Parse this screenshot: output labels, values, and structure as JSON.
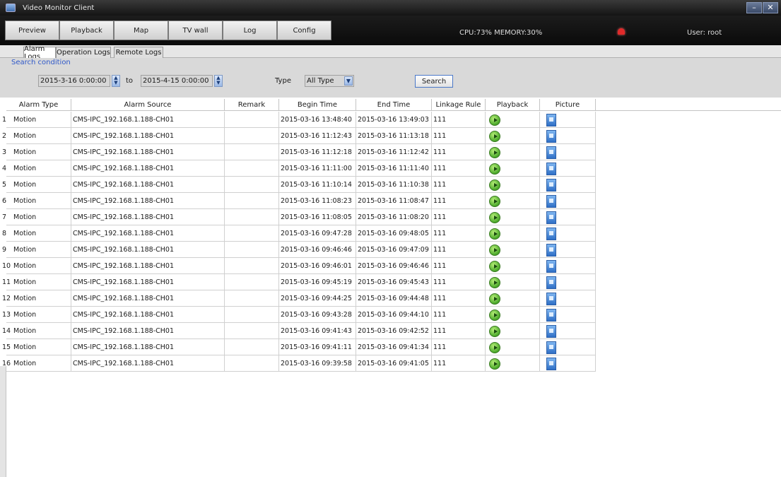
{
  "window": {
    "title": "Video Monitor Client",
    "minimize": "–",
    "close": "✕"
  },
  "menu": {
    "tabs": [
      "Preview",
      "Playback",
      "Map",
      "TV wall",
      "Log",
      "Config"
    ],
    "status": "CPU:73%  MEMORY:30%",
    "user": "User: root"
  },
  "subtabs": [
    "Alarm Logs",
    "Operation Logs",
    "Remote Logs"
  ],
  "search": {
    "legend": "Search condition",
    "start": "2015-3-16 0:00:00",
    "to_label": "to",
    "end": "2015-4-15 0:00:00",
    "type_label": "Type",
    "type_value": "All Type",
    "button": "Search"
  },
  "table": {
    "headers": [
      "Alarm Type",
      "Alarm Source",
      "Remark",
      "Begin Time",
      "End Time",
      "Linkage Rule",
      "Playback",
      "Picture"
    ],
    "rows": [
      {
        "idx": "1",
        "type": "Motion",
        "source": "CMS-IPC_192.168.1.188-CH01",
        "remark": "",
        "begin": "2015-03-16 13:48:40",
        "end": "2015-03-16 13:49:03",
        "rule": "111"
      },
      {
        "idx": "2",
        "type": "Motion",
        "source": "CMS-IPC_192.168.1.188-CH01",
        "remark": "",
        "begin": "2015-03-16 11:12:43",
        "end": "2015-03-16 11:13:18",
        "rule": "111"
      },
      {
        "idx": "3",
        "type": "Motion",
        "source": "CMS-IPC_192.168.1.188-CH01",
        "remark": "",
        "begin": "2015-03-16 11:12:18",
        "end": "2015-03-16 11:12:42",
        "rule": "111"
      },
      {
        "idx": "4",
        "type": "Motion",
        "source": "CMS-IPC_192.168.1.188-CH01",
        "remark": "",
        "begin": "2015-03-16 11:11:00",
        "end": "2015-03-16 11:11:40",
        "rule": "111"
      },
      {
        "idx": "5",
        "type": "Motion",
        "source": "CMS-IPC_192.168.1.188-CH01",
        "remark": "",
        "begin": "2015-03-16 11:10:14",
        "end": "2015-03-16 11:10:38",
        "rule": "111"
      },
      {
        "idx": "6",
        "type": "Motion",
        "source": "CMS-IPC_192.168.1.188-CH01",
        "remark": "",
        "begin": "2015-03-16 11:08:23",
        "end": "2015-03-16 11:08:47",
        "rule": "111"
      },
      {
        "idx": "7",
        "type": "Motion",
        "source": "CMS-IPC_192.168.1.188-CH01",
        "remark": "",
        "begin": "2015-03-16 11:08:05",
        "end": "2015-03-16 11:08:20",
        "rule": "111"
      },
      {
        "idx": "8",
        "type": "Motion",
        "source": "CMS-IPC_192.168.1.188-CH01",
        "remark": "",
        "begin": "2015-03-16 09:47:28",
        "end": "2015-03-16 09:48:05",
        "rule": "111"
      },
      {
        "idx": "9",
        "type": "Motion",
        "source": "CMS-IPC_192.168.1.188-CH01",
        "remark": "",
        "begin": "2015-03-16 09:46:46",
        "end": "2015-03-16 09:47:09",
        "rule": "111"
      },
      {
        "idx": "10",
        "type": "Motion",
        "source": "CMS-IPC_192.168.1.188-CH01",
        "remark": "",
        "begin": "2015-03-16 09:46:01",
        "end": "2015-03-16 09:46:46",
        "rule": "111"
      },
      {
        "idx": "11",
        "type": "Motion",
        "source": "CMS-IPC_192.168.1.188-CH01",
        "remark": "",
        "begin": "2015-03-16 09:45:19",
        "end": "2015-03-16 09:45:43",
        "rule": "111"
      },
      {
        "idx": "12",
        "type": "Motion",
        "source": "CMS-IPC_192.168.1.188-CH01",
        "remark": "",
        "begin": "2015-03-16 09:44:25",
        "end": "2015-03-16 09:44:48",
        "rule": "111"
      },
      {
        "idx": "13",
        "type": "Motion",
        "source": "CMS-IPC_192.168.1.188-CH01",
        "remark": "",
        "begin": "2015-03-16 09:43:28",
        "end": "2015-03-16 09:44:10",
        "rule": "111"
      },
      {
        "idx": "14",
        "type": "Motion",
        "source": "CMS-IPC_192.168.1.188-CH01",
        "remark": "",
        "begin": "2015-03-16 09:41:43",
        "end": "2015-03-16 09:42:52",
        "rule": "111"
      },
      {
        "idx": "15",
        "type": "Motion",
        "source": "CMS-IPC_192.168.1.188-CH01",
        "remark": "",
        "begin": "2015-03-16 09:41:11",
        "end": "2015-03-16 09:41:34",
        "rule": "111"
      },
      {
        "idx": "16",
        "type": "Motion",
        "source": "CMS-IPC_192.168.1.188-CH01",
        "remark": "",
        "begin": "2015-03-16 09:39:58",
        "end": "2015-03-16 09:41:05",
        "rule": "111"
      }
    ],
    "playback_icon": "play-icon",
    "picture_icon": "picture-icon"
  }
}
